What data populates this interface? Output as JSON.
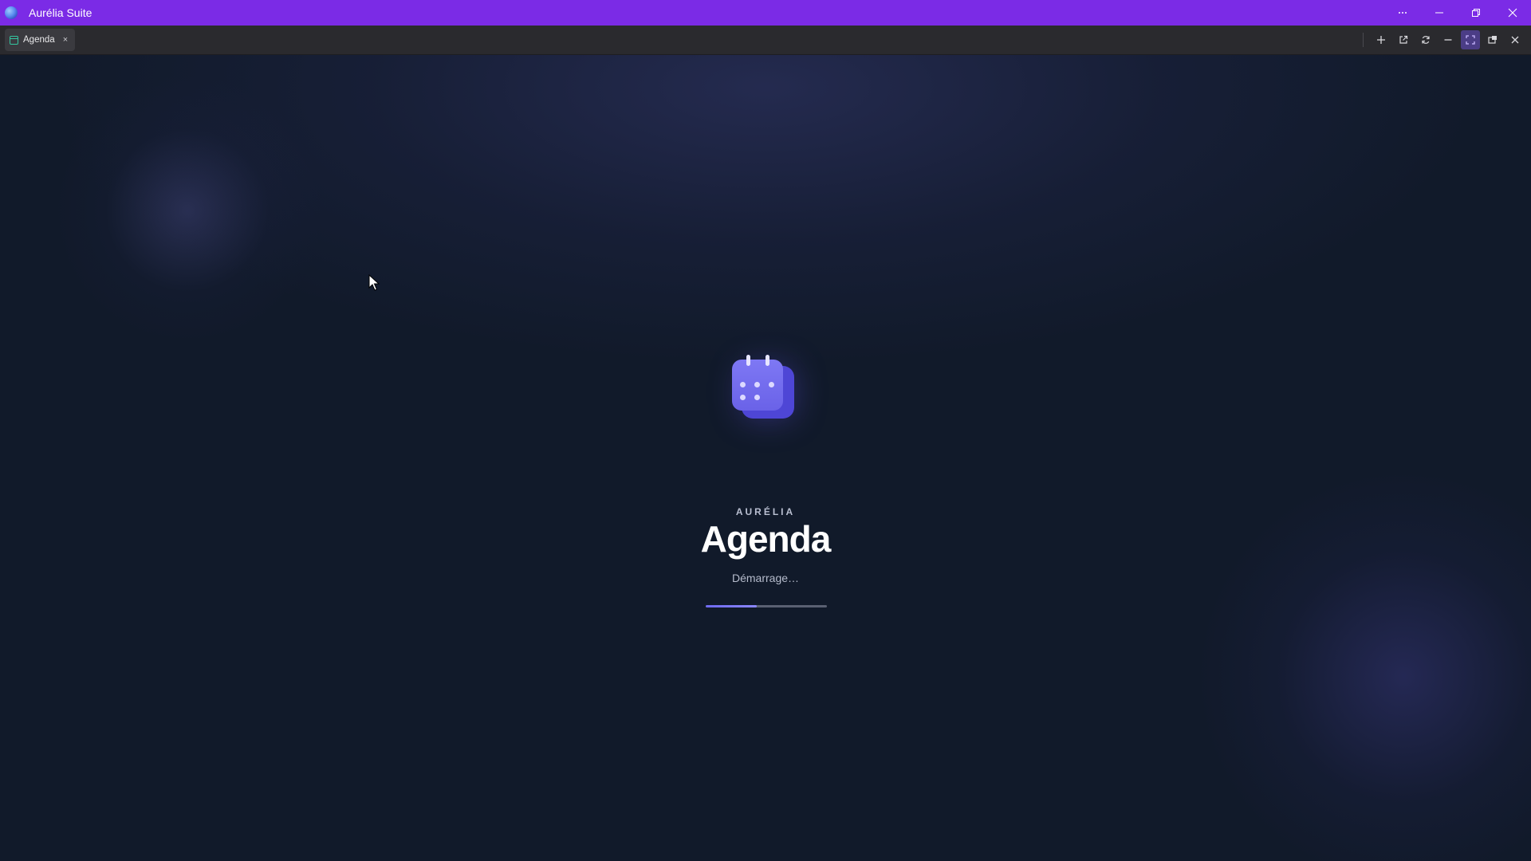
{
  "window": {
    "title": "Aurélia Suite",
    "controls": [
      "more-icon",
      "minimize-icon",
      "restore-icon",
      "close-icon"
    ]
  },
  "tabs": [
    {
      "label": "Agenda",
      "icon": "calendar-icon",
      "close": "×"
    }
  ],
  "tab_tools": [
    "plus-icon",
    "external-link-icon",
    "refresh-icon",
    "minus-icon",
    "fullscreen-icon",
    "picture-in-picture-icon",
    "close-icon"
  ],
  "splash": {
    "brand": "AURÉLIA",
    "app_name": "Agenda",
    "status": "Démarrage…",
    "progress": 0.42,
    "icon": "calendar-icon"
  },
  "colors": {
    "titlebar": "#7b2be6",
    "accent": "#6e6af0",
    "background": "#111a2a"
  }
}
